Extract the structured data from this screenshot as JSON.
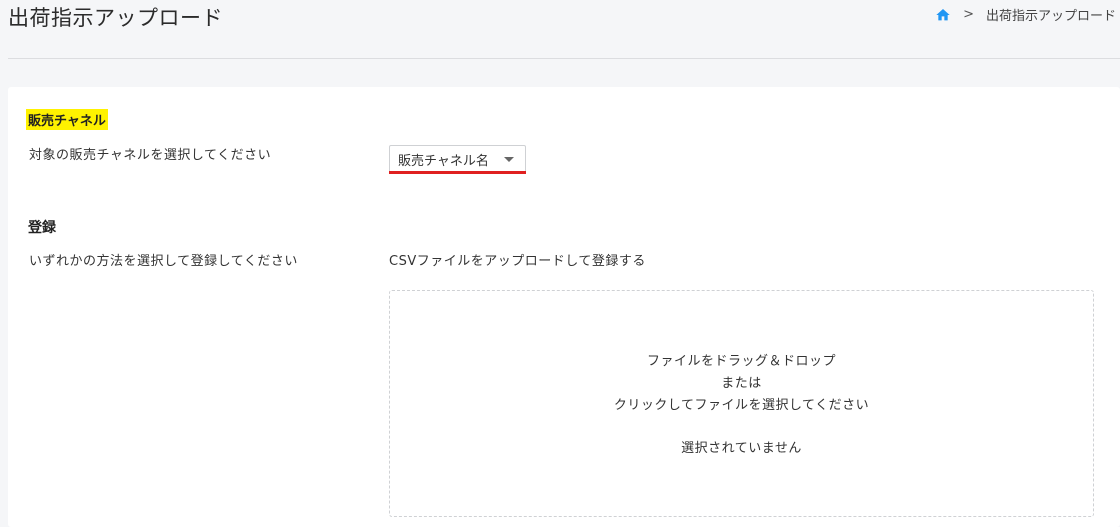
{
  "header": {
    "title": "出荷指示アップロード",
    "breadcrumb": {
      "home_icon": "home-icon",
      "separator": ">",
      "current": "出荷指示アップロード"
    }
  },
  "sales_channel": {
    "title": "販売チャネル",
    "instruction": "対象の販売チャネルを選択してください",
    "select_value": "販売チャネル名",
    "select_icon": "chevron-down-icon",
    "highlight_color": "#fff200",
    "underline_color": "#e02020"
  },
  "register": {
    "title": "登録",
    "instruction": "いずれかの方法を選択して登録してください",
    "method_label": "CSVファイルをアップロードして登録する",
    "dropzone": {
      "line1": "ファイルをドラッグ＆ドロップ",
      "line2": "または",
      "line3": "クリックしてファイルを選択してください",
      "status": "選択されていません"
    }
  },
  "colors": {
    "accent": "#2196f3",
    "background": "#f5f6f8"
  }
}
